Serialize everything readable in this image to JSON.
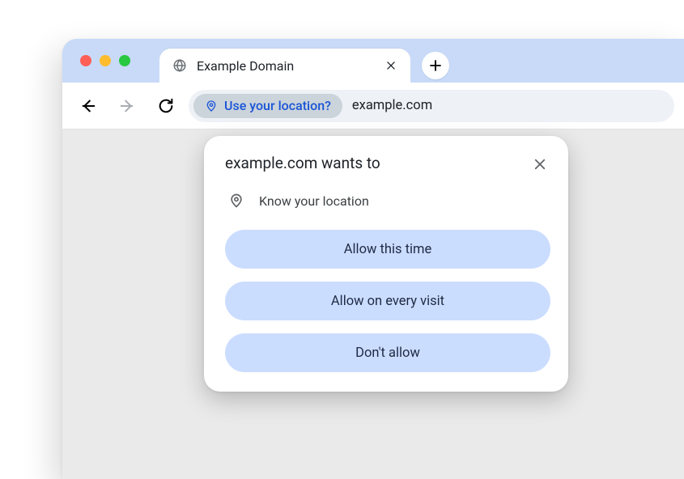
{
  "window": {
    "tab_title": "Example Domain"
  },
  "omnibox": {
    "chip_label": "Use your location?",
    "url": "example.com"
  },
  "permission_dialog": {
    "title": "example.com wants to",
    "request": "Know your location",
    "buttons": {
      "allow_once": "Allow this time",
      "allow_always": "Allow on every visit",
      "deny": "Don't allow"
    }
  }
}
